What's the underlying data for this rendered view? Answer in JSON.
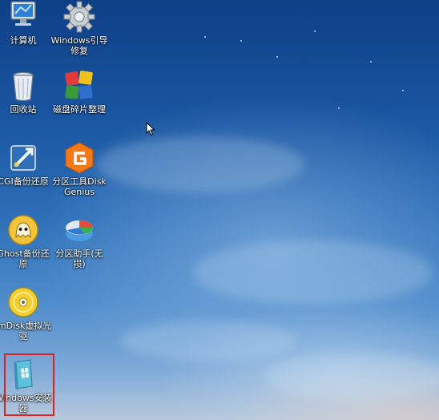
{
  "desktop_icons": [
    {
      "label": "计算机",
      "icon": "computer-icon"
    },
    {
      "label": "Windows引导修复",
      "icon": "gear-icon"
    },
    {
      "label": "回收站",
      "icon": "recycle-bin-icon"
    },
    {
      "label": "磁盘碎片整理",
      "icon": "defrag-icon"
    },
    {
      "label": "CGI备份还原",
      "icon": "cgi-backup-icon"
    },
    {
      "label": "分区工具DiskGenius",
      "icon": "diskgenius-icon"
    },
    {
      "label": "Ghost备份还原",
      "icon": "ghost-icon"
    },
    {
      "label": "分区助手(无损)",
      "icon": "partition-assistant-icon"
    },
    {
      "label": "ImDisk虚拟光驱",
      "icon": "imdisk-icon"
    },
    {
      "label": "Windows安装器",
      "icon": "windows-installer-icon"
    }
  ],
  "colors": {
    "highlight_border": "#e0201f",
    "sky_top": "#0d3f86",
    "sky_bottom": "#b8c8dc"
  }
}
